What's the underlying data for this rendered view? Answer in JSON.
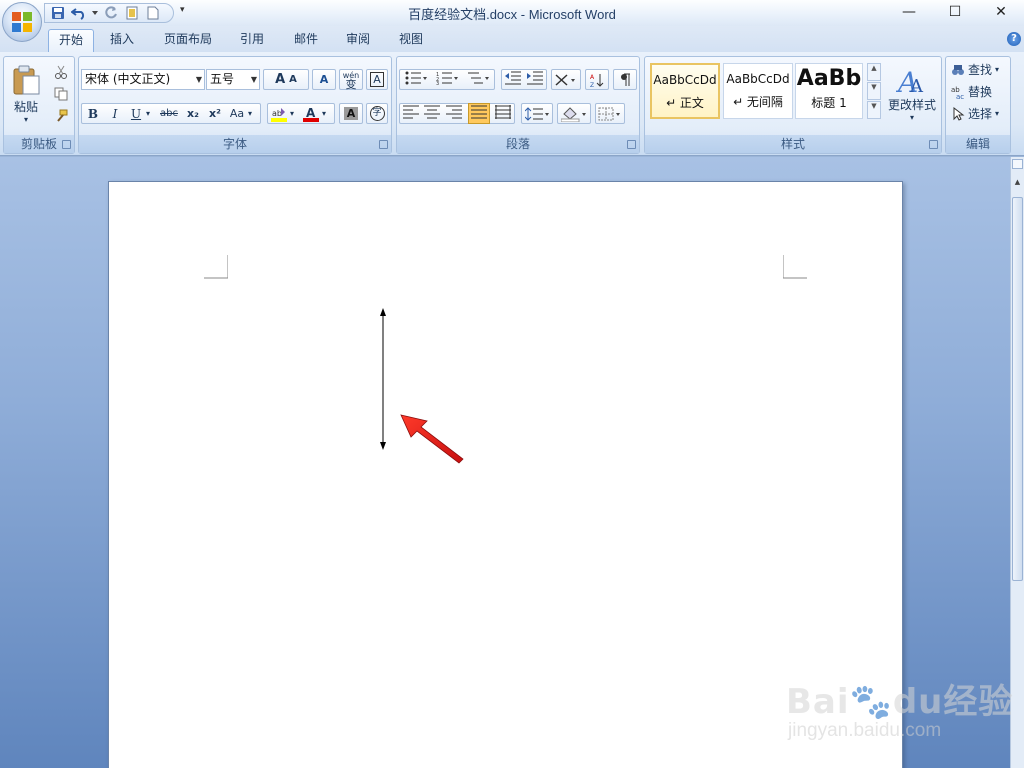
{
  "window": {
    "title": "百度经验文档.docx - Microsoft Word",
    "minimize": "—",
    "maximize": "☐",
    "close": "✕"
  },
  "qat": {
    "more": "▾"
  },
  "tabs": [
    {
      "label": "开始",
      "active": true
    },
    {
      "label": "插入"
    },
    {
      "label": "页面布局"
    },
    {
      "label": "引用"
    },
    {
      "label": "邮件"
    },
    {
      "label": "审阅"
    },
    {
      "label": "视图"
    }
  ],
  "help": "?",
  "clipboard": {
    "paste_label": "粘贴",
    "group_label": "剪贴板"
  },
  "font": {
    "font_name": "宋体 (中文正文)",
    "font_size": "五号",
    "bold": "B",
    "italic": "I",
    "underline": "U",
    "strikethrough": "abc",
    "subscript": "x₂",
    "superscript": "x²",
    "change_case": "Aa",
    "grow": "A",
    "shrink": "A",
    "clear": "A",
    "pinyin": "wén",
    "pinyin_char": "变",
    "char_border": "A",
    "text_effect": "A",
    "enclose": "字",
    "group_label": "字体"
  },
  "paragraph": {
    "group_label": "段落"
  },
  "styles": {
    "items": [
      {
        "preview": "AaBbCcDd",
        "name": "↵ 正文",
        "selected": true
      },
      {
        "preview": "AaBbCcDd",
        "name": "↵ 无间隔"
      },
      {
        "preview": "AaBb",
        "name": "标题 1"
      }
    ],
    "change_styles": "更改样式",
    "group_label": "样式"
  },
  "editing": {
    "find": "查找",
    "replace": "替换",
    "select": "选择",
    "group_label": "编辑"
  },
  "watermark": {
    "main": "Bai🐾du经验",
    "sub": "jingyan.baidu.com"
  }
}
